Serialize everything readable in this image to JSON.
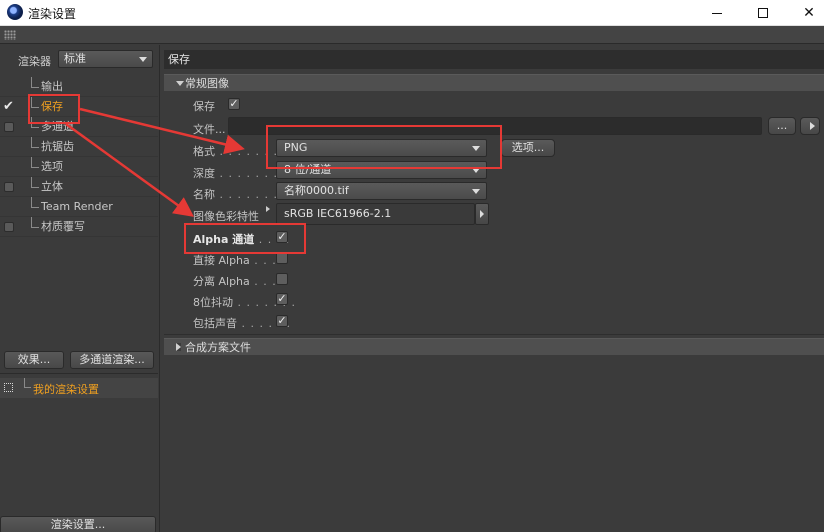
{
  "window": {
    "title": "渲染设置"
  },
  "left": {
    "renderer_label": "渲染器",
    "renderer_value": "标准",
    "items": [
      {
        "label": "输出",
        "checkbox": false,
        "checked": false,
        "active": false
      },
      {
        "label": "保存",
        "checkbox": false,
        "checked": true,
        "active": true
      },
      {
        "label": "多通道",
        "checkbox": true,
        "checked": false,
        "active": false
      },
      {
        "label": "抗锯齿",
        "checkbox": false,
        "checked": false,
        "active": false
      },
      {
        "label": "选项",
        "checkbox": false,
        "checked": false,
        "active": false
      },
      {
        "label": "立体",
        "checkbox": true,
        "checked": false,
        "active": false
      },
      {
        "label": "Team Render",
        "checkbox": false,
        "checked": false,
        "active": false
      },
      {
        "label": "材质覆写",
        "checkbox": true,
        "checked": false,
        "active": false
      }
    ],
    "effects_button": "效果...",
    "multipass_button": "多通道渲染...",
    "preset_label": "我的渲染设置",
    "render_settings_button": "渲染设置..."
  },
  "right": {
    "header": "保存",
    "group_general": "常规图像",
    "save_label": "保存",
    "file_label": "文件...",
    "file_value": "",
    "file_browse_button": "...",
    "format_label": "格式",
    "format_value": "PNG",
    "options_button": "选项...",
    "depth_label": "深度",
    "depth_value": "8 位/通道",
    "name_label": "名称",
    "name_value": "名称0000.tif",
    "color_profile_label": "图像色彩特性",
    "color_profile_value": "sRGB IEC61966-2.1",
    "alpha_label": "Alpha 通道",
    "straight_alpha_label": "直接 Alpha",
    "separate_alpha_label": "分离 Alpha",
    "dither_label": "8位抖动",
    "sound_label": "包括声音",
    "group_compositing": "合成方案文件",
    "checks": {
      "save": true,
      "alpha": true,
      "straight_alpha": false,
      "separate_alpha": false,
      "dither": true,
      "sound": true
    }
  },
  "colors": {
    "accent": "#f0a020",
    "annotation": "#e53935",
    "panel_bg": "#3b3b3b"
  }
}
